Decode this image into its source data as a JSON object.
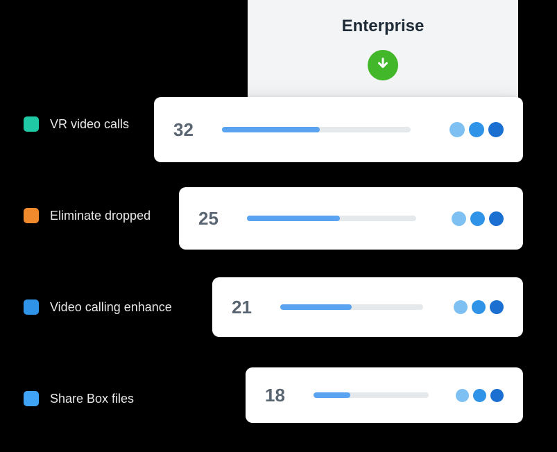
{
  "header": {
    "title": "Enterprise",
    "icon": "download-arrow-icon",
    "icon_bg": "#42b72a"
  },
  "legend": [
    {
      "color": "#20c9a6",
      "label": "VR video calls"
    },
    {
      "color": "#f08a2c",
      "label": "Eliminate dropped"
    },
    {
      "color": "#2f93e8",
      "label": "Video calling enhance"
    },
    {
      "color": "#41a3f5",
      "label": "Share Box files"
    }
  ],
  "cards": [
    {
      "value": "32",
      "progress_pct": 52
    },
    {
      "value": "25",
      "progress_pct": 55
    },
    {
      "value": "21",
      "progress_pct": 50
    },
    {
      "value": "18",
      "progress_pct": 32
    }
  ],
  "colors": {
    "progress_fill": "#5aa3f0",
    "track": "#e6e9ec",
    "dot1": "#7fc0f2",
    "dot2": "#2f93e8",
    "dot3": "#1a6fd1"
  }
}
